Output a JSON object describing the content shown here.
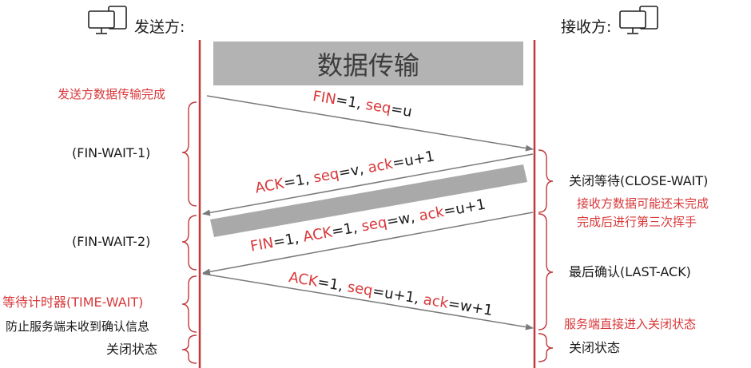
{
  "sender": {
    "label": "发送方:"
  },
  "receiver": {
    "label": "接收方:"
  },
  "banner": {
    "label": "数据传输"
  },
  "messages": {
    "fin1": {
      "k1": "FIN",
      "v1": "=1, ",
      "k2": "seq",
      "v2": "=u"
    },
    "ack1": {
      "k1": "ACK",
      "v1": "=1, ",
      "k2": "seq",
      "v2": "=v, ",
      "k3": "ack",
      "v3": "=u+1"
    },
    "fin2": {
      "k1": "FIN",
      "v1": "=1, ",
      "k2": "ACK",
      "v2": "=1, ",
      "k3": "seq",
      "v3": "=w, ",
      "k4": "ack",
      "v4": "=u+1"
    },
    "ack2": {
      "k1": "ACK",
      "v1": "=1, ",
      "k2": "seq",
      "v2": "=u+1, ",
      "k3": "ack",
      "v3": "=w+1"
    }
  },
  "sender_notes": {
    "done": "发送方数据传输完成",
    "fin_wait_1": "(FIN-WAIT-1)",
    "fin_wait_2": "(FIN-WAIT-2)",
    "time_wait": "等待计时器(TIME-WAIT)",
    "time_wait_note": "防止服务端未收到确认信息",
    "closed": "关闭状态"
  },
  "receiver_notes": {
    "close_wait": "关闭等待(CLOSE-WAIT)",
    "close_wait_note1": "接收方数据可能还未完成",
    "close_wait_note2": "完成后进行第三次挥手",
    "last_ack": "最后确认(LAST-ACK)",
    "server_close_note": "服务端直接进入关闭状态",
    "closed": "关闭状态"
  },
  "colors": {
    "timeline": "#c0393b",
    "annotation": "#d9383a",
    "arrow": "#7a7a7a",
    "banner": "#b3b3b3"
  },
  "icons": [
    "computer-icon"
  ]
}
